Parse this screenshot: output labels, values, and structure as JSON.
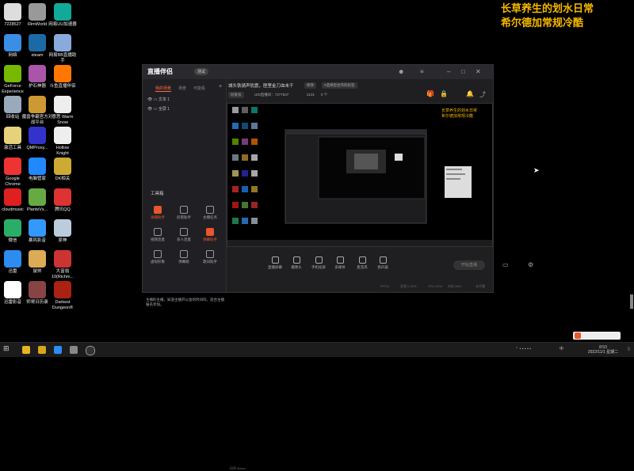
{
  "overlay": {
    "line1": "长草养生的划水日常",
    "line2": "希尔德加常规冷酷"
  },
  "desktop": {
    "col1": [
      {
        "label": "7228527",
        "icon": "tile-icon",
        "color": "#ddd"
      },
      {
        "label": "网络",
        "icon": "network-icon",
        "color": "#3a8ee6"
      },
      {
        "label": "GeForce\nExperience",
        "icon": "nvidia-icon",
        "color": "#76b900"
      },
      {
        "label": "回收站",
        "icon": "recycle-bin-icon",
        "color": "#9ab"
      },
      {
        "label": "激活工具",
        "icon": "file-icon",
        "color": "#e6d27a"
      },
      {
        "label": "Google\nChrome",
        "icon": "chrome-icon",
        "color": "#e33"
      },
      {
        "label": "cloudmusic",
        "icon": "netease-music-icon",
        "color": "#e02020"
      },
      {
        "label": "微信",
        "icon": "wechat-icon",
        "color": "#2aae67"
      },
      {
        "label": "迅雷",
        "icon": "xunlei-icon",
        "color": "#2d8cf0"
      },
      {
        "label": "迅雷影音",
        "icon": "xunlei-player-icon",
        "color": "#fff"
      }
    ],
    "col2": [
      {
        "label": "RimWorld",
        "icon": "rimworld-icon",
        "color": "#999"
      },
      {
        "label": "steam",
        "icon": "steam-icon",
        "color": "#1b6aa5"
      },
      {
        "label": "护石神器",
        "icon": "gear-app-icon",
        "color": "#a5a"
      },
      {
        "label": "魔兽争霸官方对战平台",
        "icon": "warcraft-icon",
        "color": "#c93"
      },
      {
        "label": "QMProxy...",
        "icon": "qmproxy-icon",
        "color": "#33c"
      },
      {
        "label": "电脑管家",
        "icon": "pc-manager-icon",
        "color": "#28f"
      },
      {
        "label": "PlantsVs...",
        "icon": "plants-icon",
        "color": "#6a4"
      },
      {
        "label": "暴风影音",
        "icon": "baofeng-icon",
        "color": "#39f"
      },
      {
        "label": "鼠帅",
        "icon": "character-icon",
        "color": "#da5"
      },
      {
        "label": "师哥日历录",
        "icon": "game-icon",
        "color": "#844"
      }
    ],
    "col3": [
      {
        "label": "网易UU加速器",
        "icon": "uu-accelerator-icon",
        "color": "#1a9"
      },
      {
        "label": "网易BB直播助手",
        "icon": "anime-icon",
        "color": "#8ad"
      },
      {
        "label": "斗鱼直播伴侣",
        "icon": "douyu-icon",
        "color": "#f70"
      },
      {
        "label": "意思 Warm\nSnow",
        "icon": "document-icon",
        "color": "#eee"
      },
      {
        "label": "Hollow\nKnight",
        "icon": "hollow-knight-icon",
        "color": "#eee"
      },
      {
        "label": "DK相关",
        "icon": "dk-icon",
        "color": "#ca3"
      },
      {
        "label": "腾讯QQ",
        "icon": "qq-icon",
        "color": "#d33"
      },
      {
        "label": "原神",
        "icon": "genshin-icon",
        "color": "#bcd"
      },
      {
        "label": "大富翁10(Richm...",
        "icon": "richman-icon",
        "color": "#c33"
      },
      {
        "label": "Darkest\nDungeon®",
        "icon": "darkest-dungeon-icon",
        "color": "#a21"
      }
    ]
  },
  "app": {
    "title": "直播伴侣",
    "version": "测试",
    "sidebar_tabs": [
      "我的场景",
      "场景",
      "可能看"
    ],
    "scenes": [
      "文本 1",
      "全屏 1"
    ],
    "tools_title": "工具箱",
    "tools": [
      {
        "label": "录播助手",
        "red": true
      },
      {
        "label": "房管助手",
        "red": false
      },
      {
        "label": "主播任务",
        "red": false
      },
      {
        "label": "视频连麦",
        "red": false
      },
      {
        "label": "多人连麦",
        "red": false
      },
      {
        "label": "弹幕助手",
        "red": true
      },
      {
        "label": "虚拟形象",
        "red": false
      },
      {
        "label": "弹幕姬",
        "red": false
      },
      {
        "label": "歌词助手",
        "red": false
      }
    ],
    "notice": "主播的主播，知道主播开公会的时间吗，适合主播报名参加。",
    "stream_title": "城头铁骑声犹震，匣里金刀血未干",
    "chips": [
      "修改",
      "#选择您合作的标签"
    ],
    "stats": [
      "同发号",
      "UID直播间：7277537",
      "2131",
      "0 个"
    ],
    "bottom_buttons": [
      "直播屏幕",
      "摄像头",
      "手机投屏",
      "多媒体",
      "麦克风",
      "扬声器"
    ],
    "start_label": "开始直播",
    "status": [
      "码率:0kbps",
      "FPS:0",
      "丢帧:0.00%",
      "CPU:16%",
      "内存:28%",
      "未开播"
    ]
  },
  "taskbar": {
    "time": "8:53",
    "date": "2022/11/1 星期二",
    "lang": "中"
  }
}
